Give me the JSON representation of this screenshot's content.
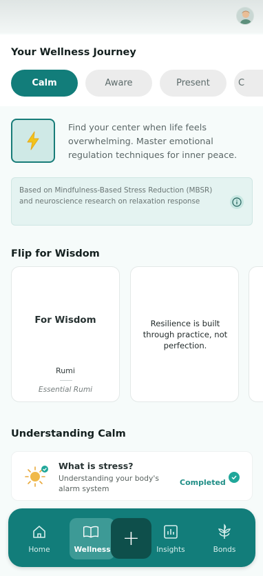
{
  "header": {
    "avatar_label": ""
  },
  "journey": {
    "title": "Your Wellness Journey",
    "tabs": [
      "Calm",
      "Aware",
      "Present",
      "C"
    ]
  },
  "focus": {
    "icon": "lightning-icon",
    "description": "Find your center when life feels overwhelming. Master emotional regulation techniques for inner peace."
  },
  "research": {
    "text": "Based on Mindfulness-Based Stress Reduction (MBSR) and neuroscience research on relaxation response"
  },
  "wisdom": {
    "title": "Flip for Wisdom",
    "cards": [
      {
        "title": "For Wisdom",
        "author": "Rumi",
        "source": "Essential Rumi"
      },
      {
        "quote": "Resilience is built through practice, not perfection."
      }
    ]
  },
  "understanding": {
    "title": "Understanding Calm",
    "topics": [
      {
        "title": "What is stress?",
        "subtitle": "Understanding your body's alarm system",
        "status": "Completed"
      }
    ]
  },
  "nav": {
    "items": [
      {
        "label": "Home",
        "icon": "home-icon"
      },
      {
        "label": "Wellness",
        "icon": "book-icon"
      },
      {
        "label": "Insights",
        "icon": "chart-icon"
      },
      {
        "label": "Bonds",
        "icon": "plant-icon"
      }
    ],
    "fab_symbol": "+"
  },
  "colors": {
    "primary": "#127d7a",
    "primary_dark": "#0e4f4b",
    "accent_light": "#cfe9e6",
    "background": "#f6fbfa"
  }
}
